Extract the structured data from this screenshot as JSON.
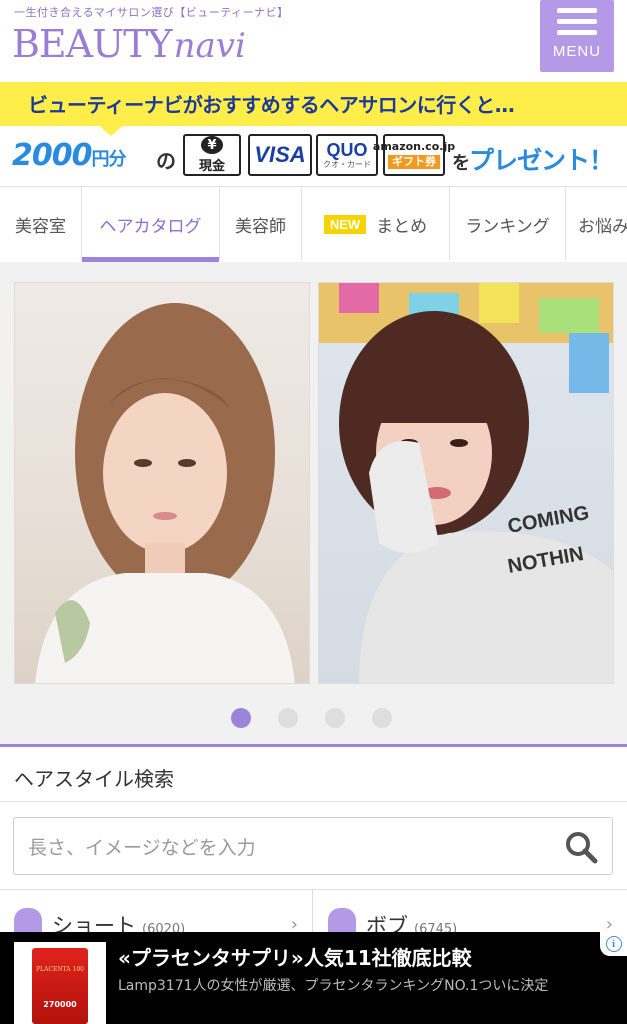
{
  "header": {
    "tagline": "一生付き合えるマイサロン選び【ビューティーナビ】",
    "logo_main": "BEAUTY",
    "logo_sub": "navi",
    "menu_label": "MENU"
  },
  "banner": {
    "headline": "ビューティーナビがおすすめするヘアサロンに行くと…",
    "amount": "2000",
    "amount_unit": "円分",
    "particle_no": "の",
    "cash_label": "現金",
    "cash_symbol": "¥",
    "visa_label": "VISA",
    "quo_label": "QUO",
    "quo_sub": "クオ・カード",
    "amazon_label": "amazon.co.jp",
    "amazon_gift": "ギフト券",
    "present_particle": "を",
    "present_text": "プレゼント！"
  },
  "tabs": [
    {
      "label": "美容室"
    },
    {
      "label": "ヘアカタログ",
      "active": true
    },
    {
      "label": "美容師"
    },
    {
      "label": "まとめ",
      "badge": "NEW"
    },
    {
      "label": "ランキング"
    },
    {
      "label": "お悩み"
    }
  ],
  "slider": {
    "page_count": 4,
    "current_page": 1
  },
  "search": {
    "title": "ヘアスタイル検索",
    "placeholder": "長さ、イメージなどを入力"
  },
  "categories": [
    {
      "label": "ショート",
      "count": "(6020)"
    },
    {
      "label": "ボブ",
      "count": "(6745)"
    }
  ],
  "ad": {
    "title": "«プラセンタサプリ»人気11社徹底比較",
    "description": "Lamp3171人の女性が厳選、プラセンタランキングNO.1ついに決定",
    "product_label": "PLACENTA 100",
    "product_number": "270000"
  },
  "colors": {
    "brand_purple": "#9a7ed6",
    "menu_bg": "#b49ae6",
    "banner_yellow": "#ffee4a",
    "banner_blue": "#2a8ae0"
  }
}
